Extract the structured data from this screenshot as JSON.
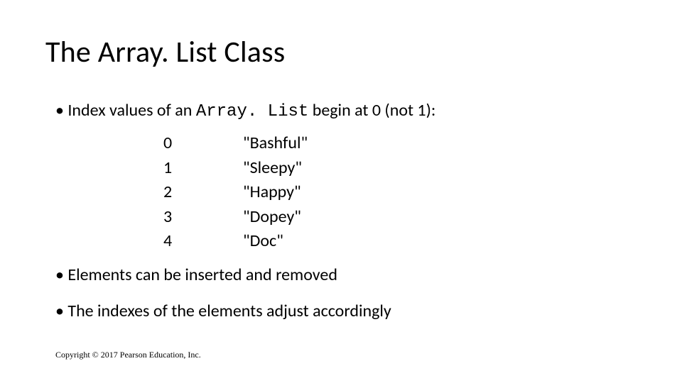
{
  "title": "The Array. List Class",
  "bullet1_pre": "• Index values of an ",
  "bullet1_code": "Array. List",
  "bullet1_post": " begin at 0 (not 1):",
  "list": {
    "rows": [
      {
        "index": "0",
        "value": "\"Bashful\""
      },
      {
        "index": "1",
        "value": "\"Sleepy\""
      },
      {
        "index": "2",
        "value": "\"Happy\""
      },
      {
        "index": "3",
        "value": "\"Dopey\""
      },
      {
        "index": "4",
        "value": "\"Doc\""
      }
    ]
  },
  "bullet2": "• Elements can be inserted and removed",
  "bullet3": "• The indexes of the elements adjust accordingly",
  "copyright": "Copyright © 2017 Pearson Education, Inc."
}
